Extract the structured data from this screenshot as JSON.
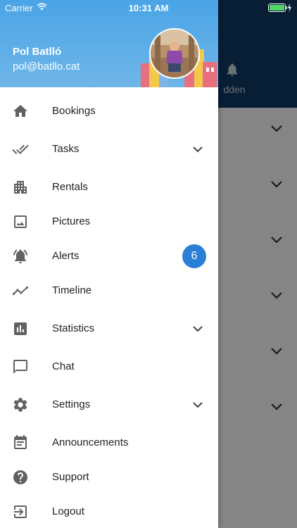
{
  "status_bar": {
    "carrier": "Carrier",
    "time": "10:31 AM"
  },
  "user": {
    "name": "Pol Batlló",
    "email": "pol@batllo.cat"
  },
  "background": {
    "tab_label": "dden"
  },
  "menu": {
    "items": [
      {
        "label": "Bookings",
        "icon": "home-icon"
      },
      {
        "label": "Tasks",
        "icon": "done-all-icon",
        "expandable": true
      },
      {
        "label": "Rentals",
        "icon": "apartment-icon"
      },
      {
        "label": "Pictures",
        "icon": "image-icon"
      },
      {
        "label": "Alerts",
        "icon": "alarm-icon",
        "badge": "6"
      },
      {
        "label": "Timeline",
        "icon": "timeline-icon"
      },
      {
        "label": "Statistics",
        "icon": "bar-chart-icon",
        "expandable": true
      },
      {
        "label": "Chat",
        "icon": "chat-icon"
      },
      {
        "label": "Settings",
        "icon": "settings-icon",
        "expandable": true
      },
      {
        "label": "Announcements",
        "icon": "event-note-icon"
      },
      {
        "label": "Support",
        "icon": "help-icon"
      },
      {
        "label": "Logout",
        "icon": "logout-icon"
      }
    ]
  },
  "colors": {
    "header": "#4aa4e6",
    "badge": "#2b80d6",
    "icon": "#616161",
    "background_header": "#0f3b66"
  }
}
